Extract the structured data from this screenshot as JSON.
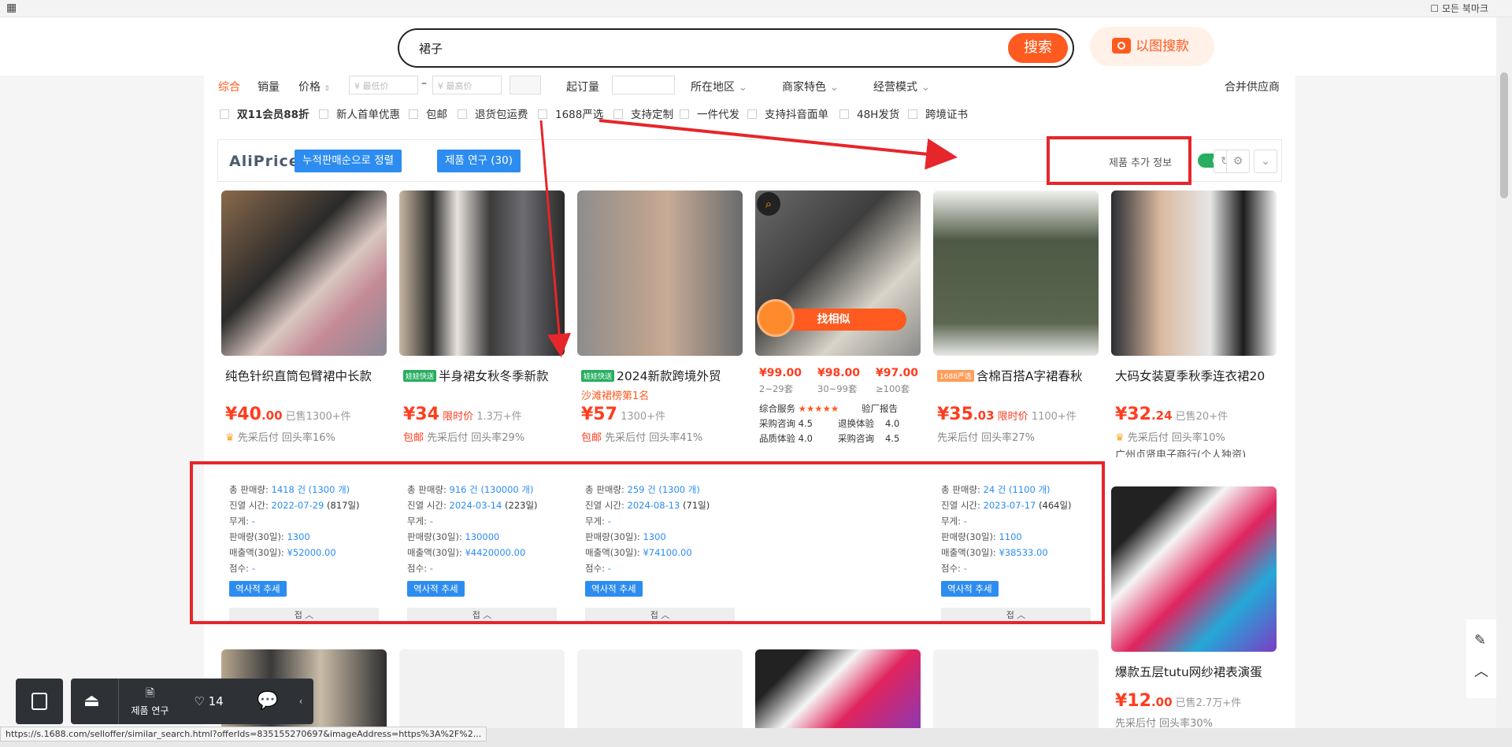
{
  "browser": {
    "bookmarks_label": "모든 북마크",
    "status_url": "https://s.1688.com/selloffer/similar_search.html?offerIds=835155270697&imageAddress=https%3A%2F%2..."
  },
  "search": {
    "query": "裙子",
    "button": "搜索",
    "image_search": "以图搜款"
  },
  "filters": {
    "sort": [
      "综合",
      "销量",
      "价格"
    ],
    "min_price_placeholder": "¥ 最低价",
    "max_price_placeholder": "¥ 最高价",
    "dash": "–",
    "moq_label": "起订量",
    "dropdowns": [
      "所在地区",
      "商家特色",
      "经营模式"
    ],
    "merge_supplier": "合并供应商",
    "checkboxes": [
      "双11会员88折",
      "新人首单优惠",
      "包邮",
      "退货包运费",
      "1688严选",
      "支持定制",
      "一件代发",
      "支持抖音面单",
      "48H发货",
      "跨境证书"
    ]
  },
  "aliprice": {
    "logo": "AliPrice",
    "sort_button": "누적판매순으로 정렬",
    "research_button": "제품 연구 (30)",
    "extra_info_label": "제품 추가 정보",
    "toggle_on": true
  },
  "products": [
    {
      "title": "纯色针织直筒包臂裙中长款",
      "tag": "",
      "sub": "",
      "price_int": "¥40",
      "price_dec": ".00",
      "price_note": "已售1300+件",
      "line2": "先采后付  回头率16%",
      "line2_prefix": "",
      "line3": "",
      "stats": {
        "total_sales": "1418 건 (1300 개)",
        "listed": "2022-07-29",
        "listed_days": "(817일)",
        "weight": "-",
        "sales30": "1300",
        "revenue30": "¥52000.00",
        "score": "-"
      }
    },
    {
      "title": "半身裙女秋冬季新款",
      "tag": "娃娃快送",
      "sub": "",
      "price_int": "¥34",
      "price_dec": "",
      "price_note_red": "限时价",
      "price_note": "1.3万+件",
      "line2": "先采后付  回头率29%",
      "line2_prefix": "包邮",
      "line3": "",
      "stats": {
        "total_sales": "916 건 (130000 개)",
        "listed": "2024-03-14",
        "listed_days": "(223일)",
        "weight": "-",
        "sales30": "130000",
        "revenue30": "¥4420000.00",
        "score": "-"
      }
    },
    {
      "title": "2024新款跨境外贸",
      "tag": "娃娃快送",
      "sub": "沙滩裙榜第1名",
      "price_int": "¥57",
      "price_dec": "",
      "price_note": "1300+件",
      "line2": "先采后付  回头率41%",
      "line2_prefix": "包邮",
      "line3": "",
      "stats": {
        "total_sales": "259 건 (1300 개)",
        "listed": "2024-08-13",
        "listed_days": "(71일)",
        "weight": "-",
        "sales30": "1300",
        "revenue30": "¥74100.00",
        "score": "-"
      }
    },
    {
      "title": "",
      "overlay": "找相似",
      "tiers": [
        {
          "p": "¥99.00",
          "q": "2~29套"
        },
        {
          "p": "¥98.00",
          "q": "30~99套"
        },
        {
          "p": "¥97.00",
          "q": "≥100套"
        }
      ],
      "service_label": "综合服务",
      "report": "验厂报告",
      "metrics": [
        [
          "采购咨询",
          "4.5",
          "退换体验",
          "4.0"
        ],
        [
          "品质体验",
          "4.0",
          "采购咨询",
          "4.5"
        ]
      ]
    },
    {
      "title": "含棉百搭A字裙春秋",
      "tag": "1688严选",
      "sub": "",
      "price_int": "¥35",
      "price_dec": ".03",
      "price_note_red": "限时价",
      "price_note": "1100+件",
      "line2": "先采后付  回头率27%",
      "line2_prefix": "",
      "line3": "",
      "stats": {
        "total_sales": "24 건 (1100 개)",
        "listed": "2023-07-17",
        "listed_days": "(464일)",
        "weight": "-",
        "sales30": "1100",
        "revenue30": "¥38533.00",
        "score": "-"
      }
    },
    {
      "title": "大码女装夏季秋季连衣裙20",
      "tag": "",
      "sub": "",
      "price_int": "¥32",
      "price_dec": ".24",
      "price_note": "已售20+件",
      "line2": "先采后付  回头率10%",
      "line2_prefix": "",
      "line3": "广州贞贤电子商行(个人独资)"
    }
  ],
  "stat_labels": {
    "total_sales": "총 판매량:",
    "listed": "진열 시간:",
    "weight": "무게:",
    "sales30": "판매량(30일):",
    "revenue30": "매출액(30일):",
    "score": "점수:",
    "history": "역사적 추세",
    "collapse": "접 ︿"
  },
  "second_row": [
    {
      "title": "爆款五层tutu网纱裙表演蛋",
      "price_int": "¥12",
      "price_dec": ".00",
      "price_note": "已售2.7万+件",
      "line2": "先采后付  回头率30%"
    }
  ],
  "dock": {
    "research": "제품 연구",
    "likes": "14"
  }
}
